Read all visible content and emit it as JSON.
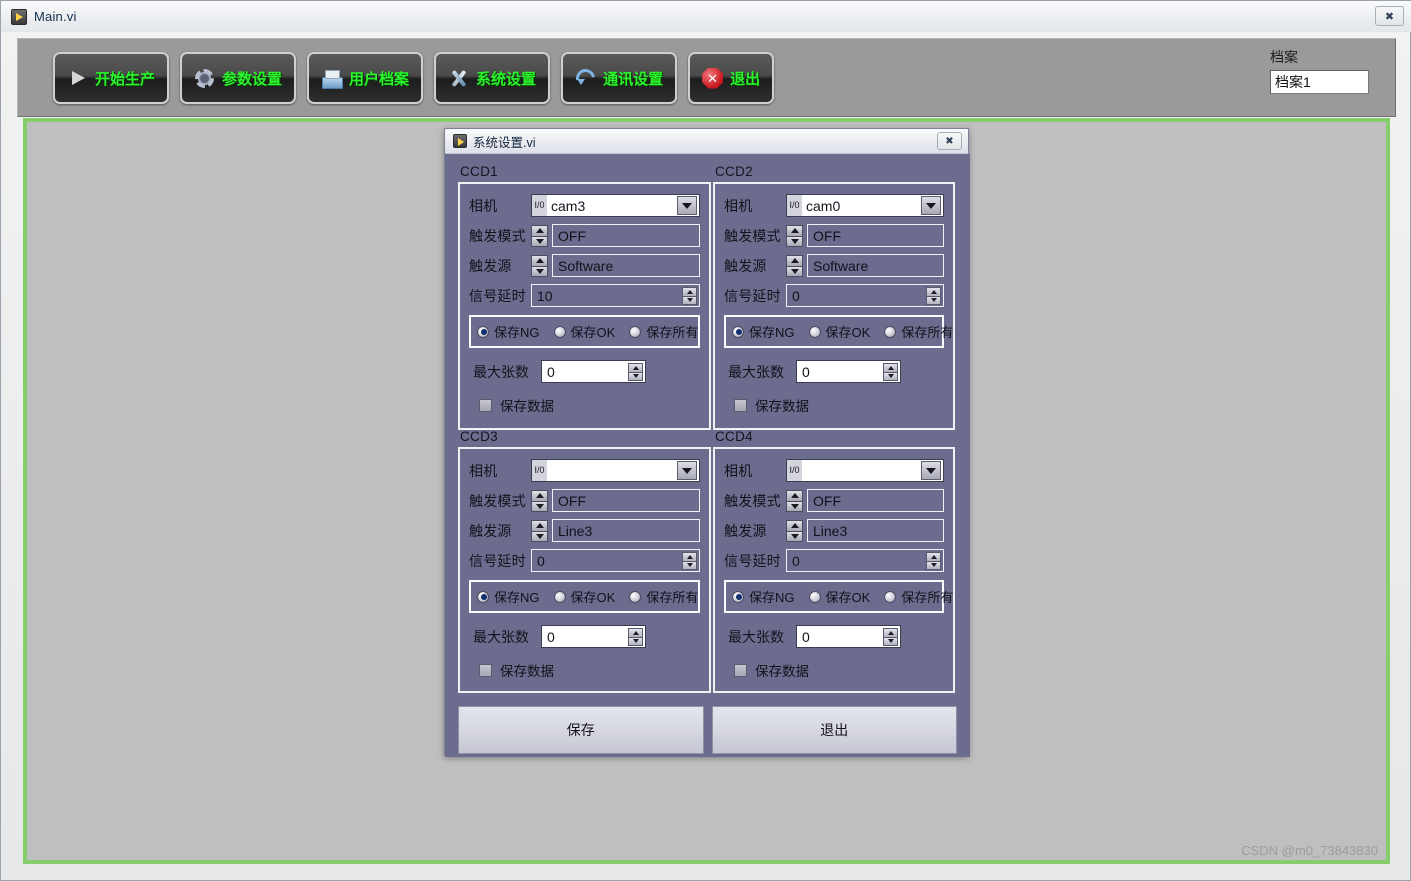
{
  "window": {
    "title": "Main.vi",
    "close_label": "✖",
    "icon": "labview-run-icon"
  },
  "toolbar": {
    "buttons": [
      {
        "label": "开始生产",
        "icon": "play-icon"
      },
      {
        "label": "参数设置",
        "icon": "gear-icon"
      },
      {
        "label": "用户档案",
        "icon": "folder-icon"
      },
      {
        "label": "系统设置",
        "icon": "tools-icon"
      },
      {
        "label": "通讯设置",
        "icon": "sync-icon"
      },
      {
        "label": "退出",
        "icon": "stop-icon"
      }
    ],
    "archive": {
      "label": "档案",
      "value": "档案1",
      "placeholder": ""
    }
  },
  "canvas": {
    "watermark": "CSDN @m0_73843830",
    "border_color": "#86cd6c",
    "background_color": "#bfbfbf"
  },
  "dialog": {
    "title": "系统设置.vi",
    "close_label": "✖",
    "icon": "labview-run-icon",
    "panel_color": "#6b6c8e",
    "labels": {
      "camera": "相机",
      "trigger_mode": "触发模式",
      "trigger_source": "触发源",
      "signal_delay": "信号延时",
      "max_count": "最大张数",
      "save_data": "保存数据",
      "io_glyph": "I/0"
    },
    "radio_options": [
      "保存NG",
      "保存OK",
      "保存所有"
    ],
    "ccd_panels": [
      {
        "title": "CCD1",
        "camera": "cam3",
        "trigger_mode": "OFF",
        "trigger_source": "Software",
        "signal_delay": "10",
        "selected_radio": 0,
        "max_count": "0",
        "save_data_checked": false
      },
      {
        "title": "CCD2",
        "camera": "cam0",
        "trigger_mode": "OFF",
        "trigger_source": "Software",
        "signal_delay": "0",
        "selected_radio": 0,
        "max_count": "0",
        "save_data_checked": false
      },
      {
        "title": "CCD3",
        "camera": "",
        "trigger_mode": "OFF",
        "trigger_source": "Line3",
        "signal_delay": "0",
        "selected_radio": 0,
        "max_count": "0",
        "save_data_checked": false
      },
      {
        "title": "CCD4",
        "camera": "",
        "trigger_mode": "OFF",
        "trigger_source": "Line3",
        "signal_delay": "0",
        "selected_radio": 0,
        "max_count": "0",
        "save_data_checked": false
      }
    ],
    "actions": {
      "save": "保存",
      "exit": "退出"
    }
  }
}
